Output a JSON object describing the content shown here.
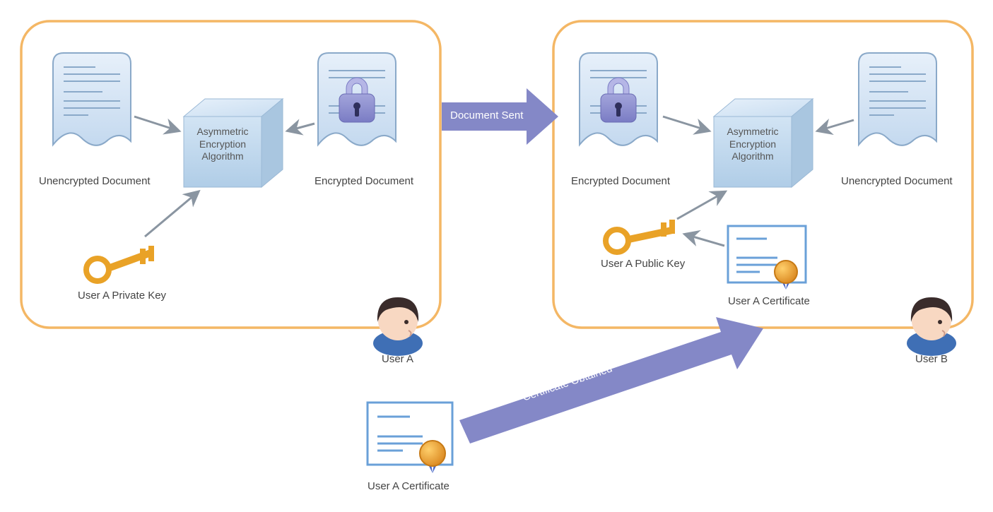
{
  "labels": {
    "userA": "User A",
    "userB": "User B",
    "unencryptedDocA": "Unencrypted Document",
    "encryptedDocA": "Encrypted Document",
    "algoA": "Asymmetric\nEncryption\nAlgorithm",
    "privateKeyA": "User A Private Key",
    "encryptedDocB": "Encrypted Document",
    "unencryptedDocB": "Unencrypted Document",
    "algoB": "Asymmetric\nEncryption\nAlgorithm",
    "publicKeyB": "User A Public Key",
    "certB": "User A Certificate",
    "certSource": "User A Certificate",
    "documentSent": "Document Sent",
    "certObtained": "Certificate Obtained"
  },
  "colors": {
    "containerBorder": "#f4b765",
    "containerFill": "#ffffff",
    "docFill": "#cfe1f3",
    "docStroke": "#8aa9c9",
    "cubeFace": "#bfd7ed",
    "cubeTop": "#d9e8f6",
    "cubeSide": "#a9c6e0",
    "lockBody": "#8a8bd0",
    "lockShackle": "#b5b6e6",
    "arrowGray": "#8a95a1",
    "flowArrow": "#8488c7",
    "keyGold": "#e9a227",
    "certPaper": "#ffffff",
    "certBorder": "#6aa0d8",
    "sealGold": "#e9a227",
    "ribbonBlue": "#4a68c8",
    "userHair": "#3a2c2b",
    "userSkin": "#f8d8c2",
    "userShirt": "#3f6fb5"
  }
}
